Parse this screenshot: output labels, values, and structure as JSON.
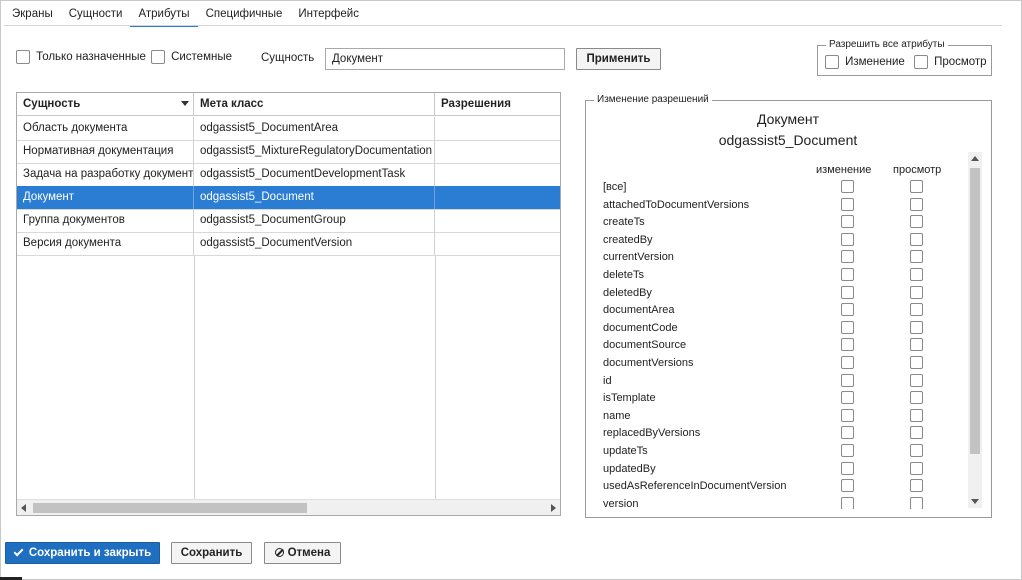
{
  "tabs": [
    {
      "label": "Экраны",
      "active": false
    },
    {
      "label": "Сущности",
      "active": false
    },
    {
      "label": "Атрибуты",
      "active": true
    },
    {
      "label": "Специфичные",
      "active": false
    },
    {
      "label": "Интерфейс",
      "active": false
    }
  ],
  "filters": {
    "only_assigned": "Только назначенные",
    "system": "Системные",
    "entity_label": "Сущность",
    "entity_value": "Документ",
    "apply": "Применить"
  },
  "allow_all": {
    "legend": "Разрешить все атрибуты",
    "change": "Изменение",
    "view": "Просмотр"
  },
  "table": {
    "columns": [
      "Сущность",
      "Мета класс",
      "Разрешения"
    ],
    "rows": [
      {
        "entity": "Область документа",
        "meta": "odgassist5_DocumentArea",
        "perm": "",
        "selected": false
      },
      {
        "entity": "Нормативная документация",
        "meta": "odgassist5_MixtureRegulatoryDocumentation",
        "perm": "",
        "selected": false
      },
      {
        "entity": "Задача на разработку документа",
        "meta": "odgassist5_DocumentDevelopmentTask",
        "perm": "",
        "selected": false
      },
      {
        "entity": "Документ",
        "meta": "odgassist5_Document",
        "perm": "",
        "selected": true
      },
      {
        "entity": "Группа документов",
        "meta": "odgassist5_DocumentGroup",
        "perm": "",
        "selected": false
      },
      {
        "entity": "Версия документа",
        "meta": "odgassist5_DocumentVersion",
        "perm": "",
        "selected": false
      }
    ]
  },
  "permissions": {
    "legend": "Изменение разрешений",
    "title": "Документ",
    "subtitle": "odgassist5_Document",
    "col_change": "изменение",
    "col_view": "просмотр",
    "attributes": [
      "[все]",
      "attachedToDocumentVersions",
      "createTs",
      "createdBy",
      "currentVersion",
      "deleteTs",
      "deletedBy",
      "documentArea",
      "documentCode",
      "documentSource",
      "documentVersions",
      "id",
      "isTemplate",
      "name",
      "replacedByVersions",
      "updateTs",
      "updatedBy",
      "usedAsReferenceInDocumentVersion",
      "version"
    ]
  },
  "footer": {
    "save_close": "Сохранить и закрыть",
    "save": "Сохранить",
    "cancel": "Отмена"
  },
  "colors": {
    "accent": "#2b7cd3",
    "primary_button": "#1f6fc0"
  }
}
